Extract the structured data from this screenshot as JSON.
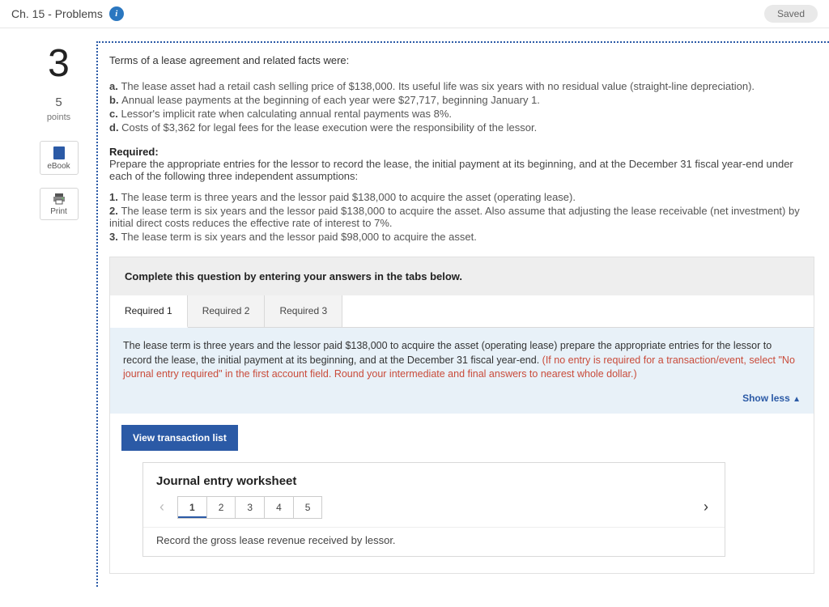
{
  "header": {
    "title": "Ch. 15 - Problems",
    "saved_label": "Saved"
  },
  "sidebar": {
    "question_number": "3",
    "points_value": "5",
    "points_label": "points",
    "ebook_label": "eBook",
    "print_label": "Print"
  },
  "question": {
    "intro": "Terms of a lease agreement and related facts were:",
    "facts": [
      {
        "lead": "a.",
        "text": "The lease asset had a retail cash selling price of $138,000. Its useful life was six years with no residual value (straight-line depreciation)."
      },
      {
        "lead": "b.",
        "text": "Annual lease payments at the beginning of each year were $27,717, beginning January 1."
      },
      {
        "lead": "c.",
        "text": "Lessor's implicit rate when calculating annual rental payments was 8%."
      },
      {
        "lead": "d.",
        "text": "Costs of $3,362 for legal fees for the lease execution were the responsibility of the lessor."
      }
    ],
    "required_label": "Required:",
    "required_text": "Prepare the appropriate entries for the lessor to record the lease, the initial payment at its beginning, and at the December 31 fiscal year-end under each of the following three independent assumptions:",
    "assumptions": [
      {
        "lead": "1.",
        "text": "The lease term is three years and the lessor paid $138,000 to acquire the asset (operating lease)."
      },
      {
        "lead": "2.",
        "text": "The lease term is six years and the lessor paid $138,000 to acquire the asset. Also assume that adjusting the lease receivable (net investment) by initial direct costs reduces the effective rate of interest to 7%."
      },
      {
        "lead": "3.",
        "text": "The lease term is six years and the lessor paid $98,000 to acquire the asset."
      }
    ]
  },
  "answer": {
    "cta": "Complete this question by entering your answers in the tabs below.",
    "tabs": [
      {
        "label": "Required 1",
        "active": true
      },
      {
        "label": "Required 2",
        "active": false
      },
      {
        "label": "Required 3",
        "active": false
      }
    ],
    "panel_main": "The lease term is three years and the lessor paid $138,000 to acquire the asset (operating lease) prepare the appropriate entries for the lessor to record the lease, the initial payment at its beginning, and at the December 31 fiscal year-end. ",
    "panel_hint": "(If no entry is required for a transaction/event, select \"No journal entry required\" in the first account field. Round your intermediate and final answers to nearest whole dollar.)",
    "show_less": "Show less",
    "view_trans": "View transaction list",
    "worksheet_title": "Journal entry worksheet",
    "steps": [
      "1",
      "2",
      "3",
      "4",
      "5"
    ],
    "active_step": "1",
    "instruction": "Record the gross lease revenue received by lessor."
  }
}
